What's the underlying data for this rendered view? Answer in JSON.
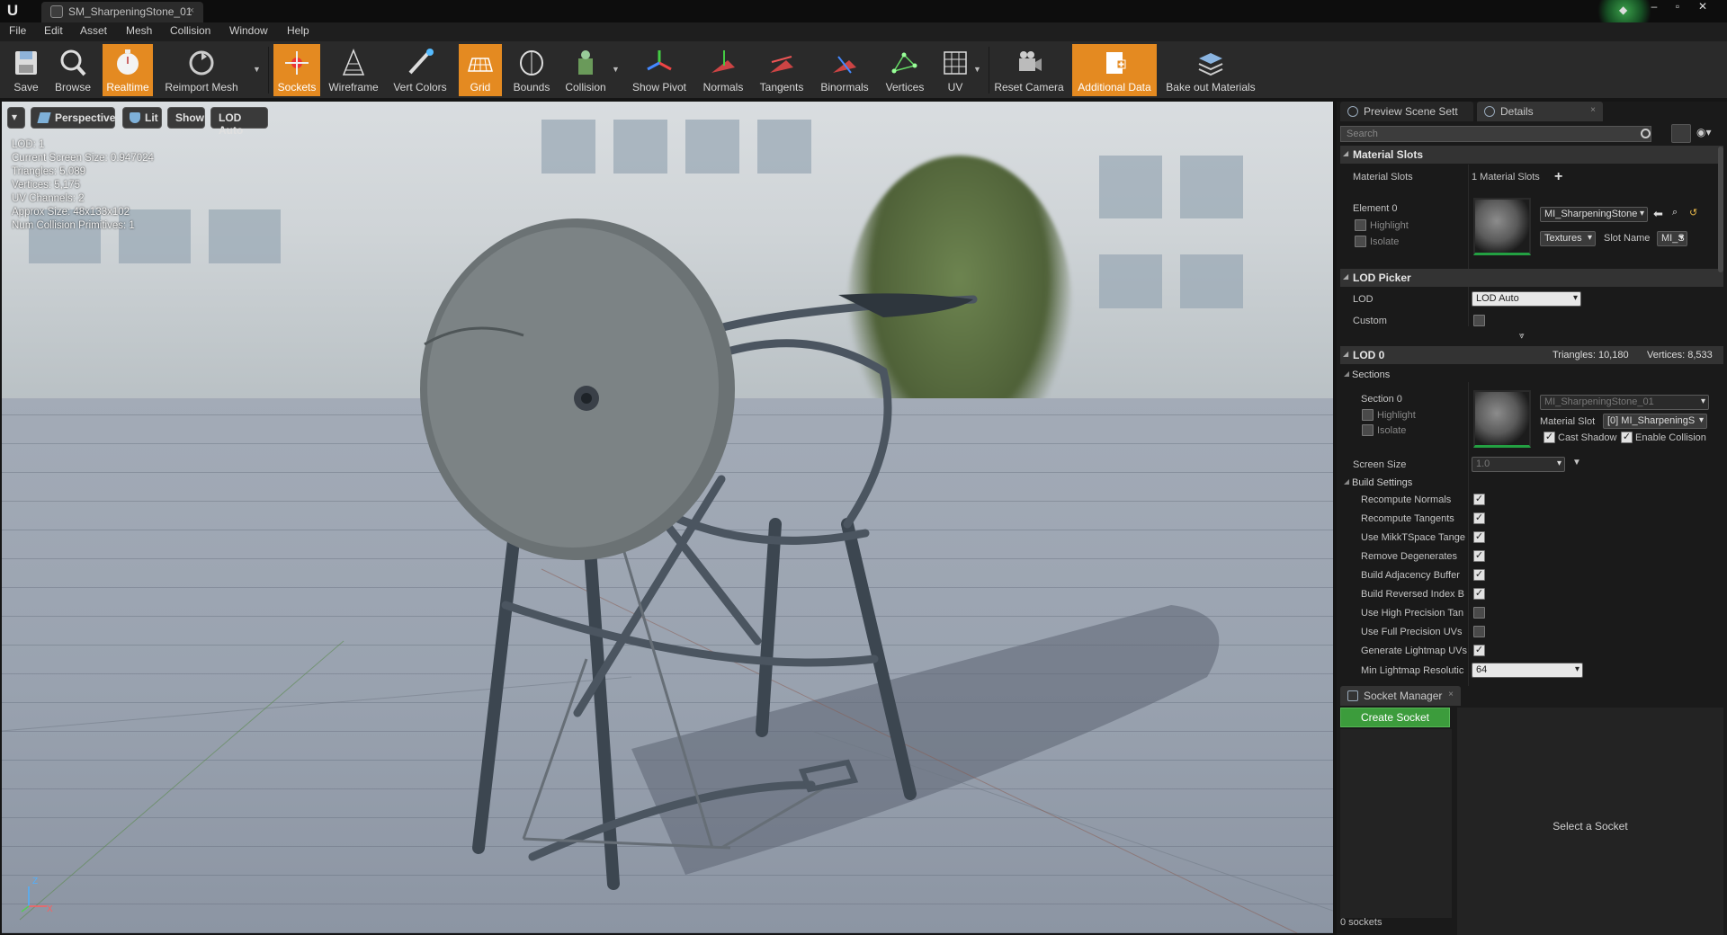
{
  "window": {
    "tab_title": "SM_SharpeningStone_01",
    "tab_close": "×",
    "logo": "U",
    "controls": [
      "–",
      "▫",
      "✕"
    ]
  },
  "menu": [
    "File",
    "Edit",
    "Asset",
    "Mesh",
    "Collision",
    "Window",
    "Help"
  ],
  "toolbar": [
    {
      "label": "Save",
      "icon": "save-icon",
      "active": false
    },
    {
      "label": "Browse",
      "icon": "browse-icon",
      "active": false
    },
    {
      "label": "Realtime",
      "icon": "realtime-icon",
      "active": true
    },
    {
      "label": "Reimport Mesh",
      "icon": "reimport-icon",
      "active": false
    },
    {
      "label": "Sockets",
      "icon": "sockets-icon",
      "active": true
    },
    {
      "label": "Wireframe",
      "icon": "wireframe-icon",
      "active": false
    },
    {
      "label": "Vert Colors",
      "icon": "vert-colors-icon",
      "active": false
    },
    {
      "label": "Grid",
      "icon": "grid-icon",
      "active": true
    },
    {
      "label": "Bounds",
      "icon": "bounds-icon",
      "active": false
    },
    {
      "label": "Collision",
      "icon": "collision-icon",
      "active": false
    },
    {
      "label": "Show Pivot",
      "icon": "pivot-icon",
      "active": false
    },
    {
      "label": "Normals",
      "icon": "normals-icon",
      "active": false
    },
    {
      "label": "Tangents",
      "icon": "tangents-icon",
      "active": false
    },
    {
      "label": "Binormals",
      "icon": "binormals-icon",
      "active": false
    },
    {
      "label": "Vertices",
      "icon": "vertices-icon",
      "active": false
    },
    {
      "label": "UV",
      "icon": "uv-icon",
      "active": false
    },
    {
      "label": "Reset Camera",
      "icon": "camera-icon",
      "active": false
    },
    {
      "label": "Additional Data",
      "icon": "additional-data-icon",
      "active": true
    },
    {
      "label": "Bake out Materials",
      "icon": "bake-icon",
      "active": false
    }
  ],
  "viewport": {
    "buttons": {
      "menu": "▾",
      "perspective": "Perspective",
      "lit": "Lit",
      "show": "Show",
      "lod": "LOD Auto"
    },
    "stats": [
      "LOD:  1",
      "Current Screen Size:  0.947024",
      "Triangles:  5,089",
      "Vertices:  5,175",
      "UV Channels:  2",
      "Approx Size: 48x133x102",
      "Num Collision Primitives:  1"
    ],
    "axis_z": "Z",
    "axis_x": "X"
  },
  "details": {
    "tabs": {
      "preview": "Preview Scene Sett",
      "details": "Details",
      "close": "×"
    },
    "search_placeholder": "Search",
    "material_slots": {
      "header": "Material Slots",
      "label": "Material Slots",
      "value": "1 Material Slots",
      "add": "+",
      "element_label": "Element 0",
      "highlight": "Highlight",
      "isolate": "Isolate",
      "material_name": "MI_SharpeningStone",
      "textures": "Textures",
      "slot_name_label": "Slot Name",
      "slot_name_value": "MI_S"
    },
    "lod_picker": {
      "header": "LOD Picker",
      "lod_label": "LOD",
      "lod_value": "LOD Auto",
      "custom_label": "Custom"
    },
    "lod0": {
      "header": "LOD 0",
      "triangles": "Triangles: 10,180",
      "vertices": "Vertices: 8,533",
      "sections": "Sections",
      "section_label": "Section 0",
      "highlight": "Highlight",
      "isolate": "Isolate",
      "section_material": "MI_SharpeningStone_01",
      "material_slot_label": "Material Slot",
      "material_slot_value": "[0] MI_SharpeningS",
      "cast_shadow": "Cast Shadow",
      "enable_collision": "Enable Collision",
      "screen_size_label": "Screen Size",
      "screen_size_value": "1.0",
      "build_settings": "Build Settings",
      "build_rows": [
        {
          "label": "Recompute Normals",
          "checked": true
        },
        {
          "label": "Recompute Tangents",
          "checked": true
        },
        {
          "label": "Use MikkTSpace Tange",
          "checked": true
        },
        {
          "label": "Remove Degenerates",
          "checked": true
        },
        {
          "label": "Build Adjacency Buffer",
          "checked": true
        },
        {
          "label": "Build Reversed Index B",
          "checked": true
        },
        {
          "label": "Use High Precision Tan",
          "checked": false
        },
        {
          "label": "Use Full Precision UVs",
          "checked": false
        },
        {
          "label": "Generate Lightmap UVs",
          "checked": true
        }
      ],
      "min_lightmap_label": "Min Lightmap Resolutic",
      "min_lightmap_value": "64"
    }
  },
  "socket_manager": {
    "tab": "Socket Manager",
    "close": "×",
    "create": "Create Socket",
    "empty": "Select a Socket",
    "count": "0 sockets"
  },
  "colors": {
    "accent": "#e48a21",
    "green": "#3c9c3c",
    "panel": "#1a1a1a"
  }
}
